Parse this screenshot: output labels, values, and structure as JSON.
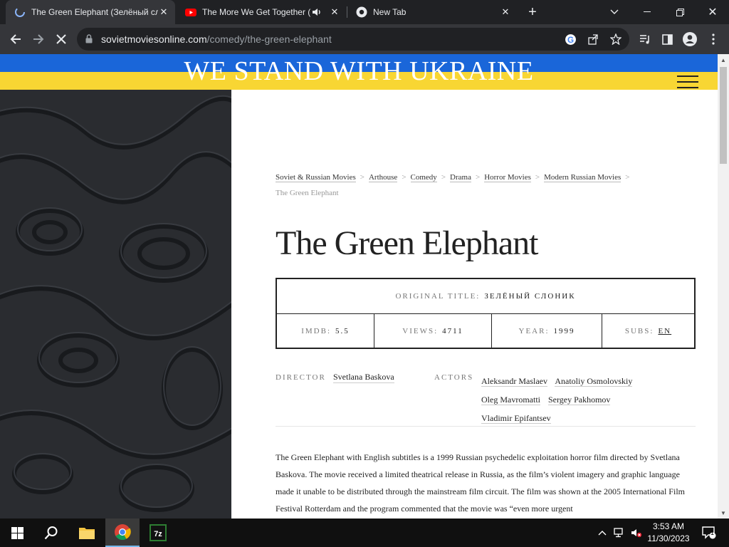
{
  "browser": {
    "tabs": [
      {
        "title": "The Green Elephant (Зелёный сл",
        "active": true
      },
      {
        "title": "The More We Get Together (",
        "active": false
      },
      {
        "title": "New Tab",
        "active": false
      }
    ],
    "url_host": "sovietmoviesonline.com",
    "url_path": "/comedy/the-green-elephant"
  },
  "banner": {
    "text": "WE STAND WITH UKRAINE",
    "colors": {
      "blue": "#1a66d9",
      "yellow": "#f8d633"
    }
  },
  "breadcrumb": {
    "items": [
      "Soviet & Russian Movies",
      "Arthouse",
      "Comedy",
      "Drama",
      "Horror Movies",
      "Modern Russian Movies"
    ],
    "current": "The Green Elephant"
  },
  "movie": {
    "title": "The Green Elephant",
    "original_title_label": "ORIGINAL TITLE:",
    "original_title": "ЗЕЛЁНЫЙ СЛОНИК",
    "imdb_label": "IMDB:",
    "imdb": "5.5",
    "views_label": "VIEWS:",
    "views": "4711",
    "year_label": "YEAR:",
    "year": "1999",
    "subs_label": "SUBS:",
    "subs": "EN",
    "director_label": "DIRECTOR",
    "director": "Svetlana Baskova",
    "actors_label": "ACTORS",
    "actors": [
      "Aleksandr Maslaev",
      "Anatoliy Osmolovskiy",
      "Oleg Mavromatti",
      "Sergey Pakhomov",
      "Vladimir Epifantsev"
    ],
    "description": "The Green Elephant with English subtitles is a 1999 Russian psychedelic exploitation horror film directed by Svetlana Baskova. The movie received a limited theatrical release in Russia, as the film’s violent imagery and graphic language made it unable to be distributed through the mainstream film circuit. The film was shown at the 2005 International Film Festival Rotterdam and the program commented that the movie was “even more urgent"
  },
  "taskbar": {
    "time": "3:53 AM",
    "date": "11/30/2023",
    "notification_count": "1"
  }
}
